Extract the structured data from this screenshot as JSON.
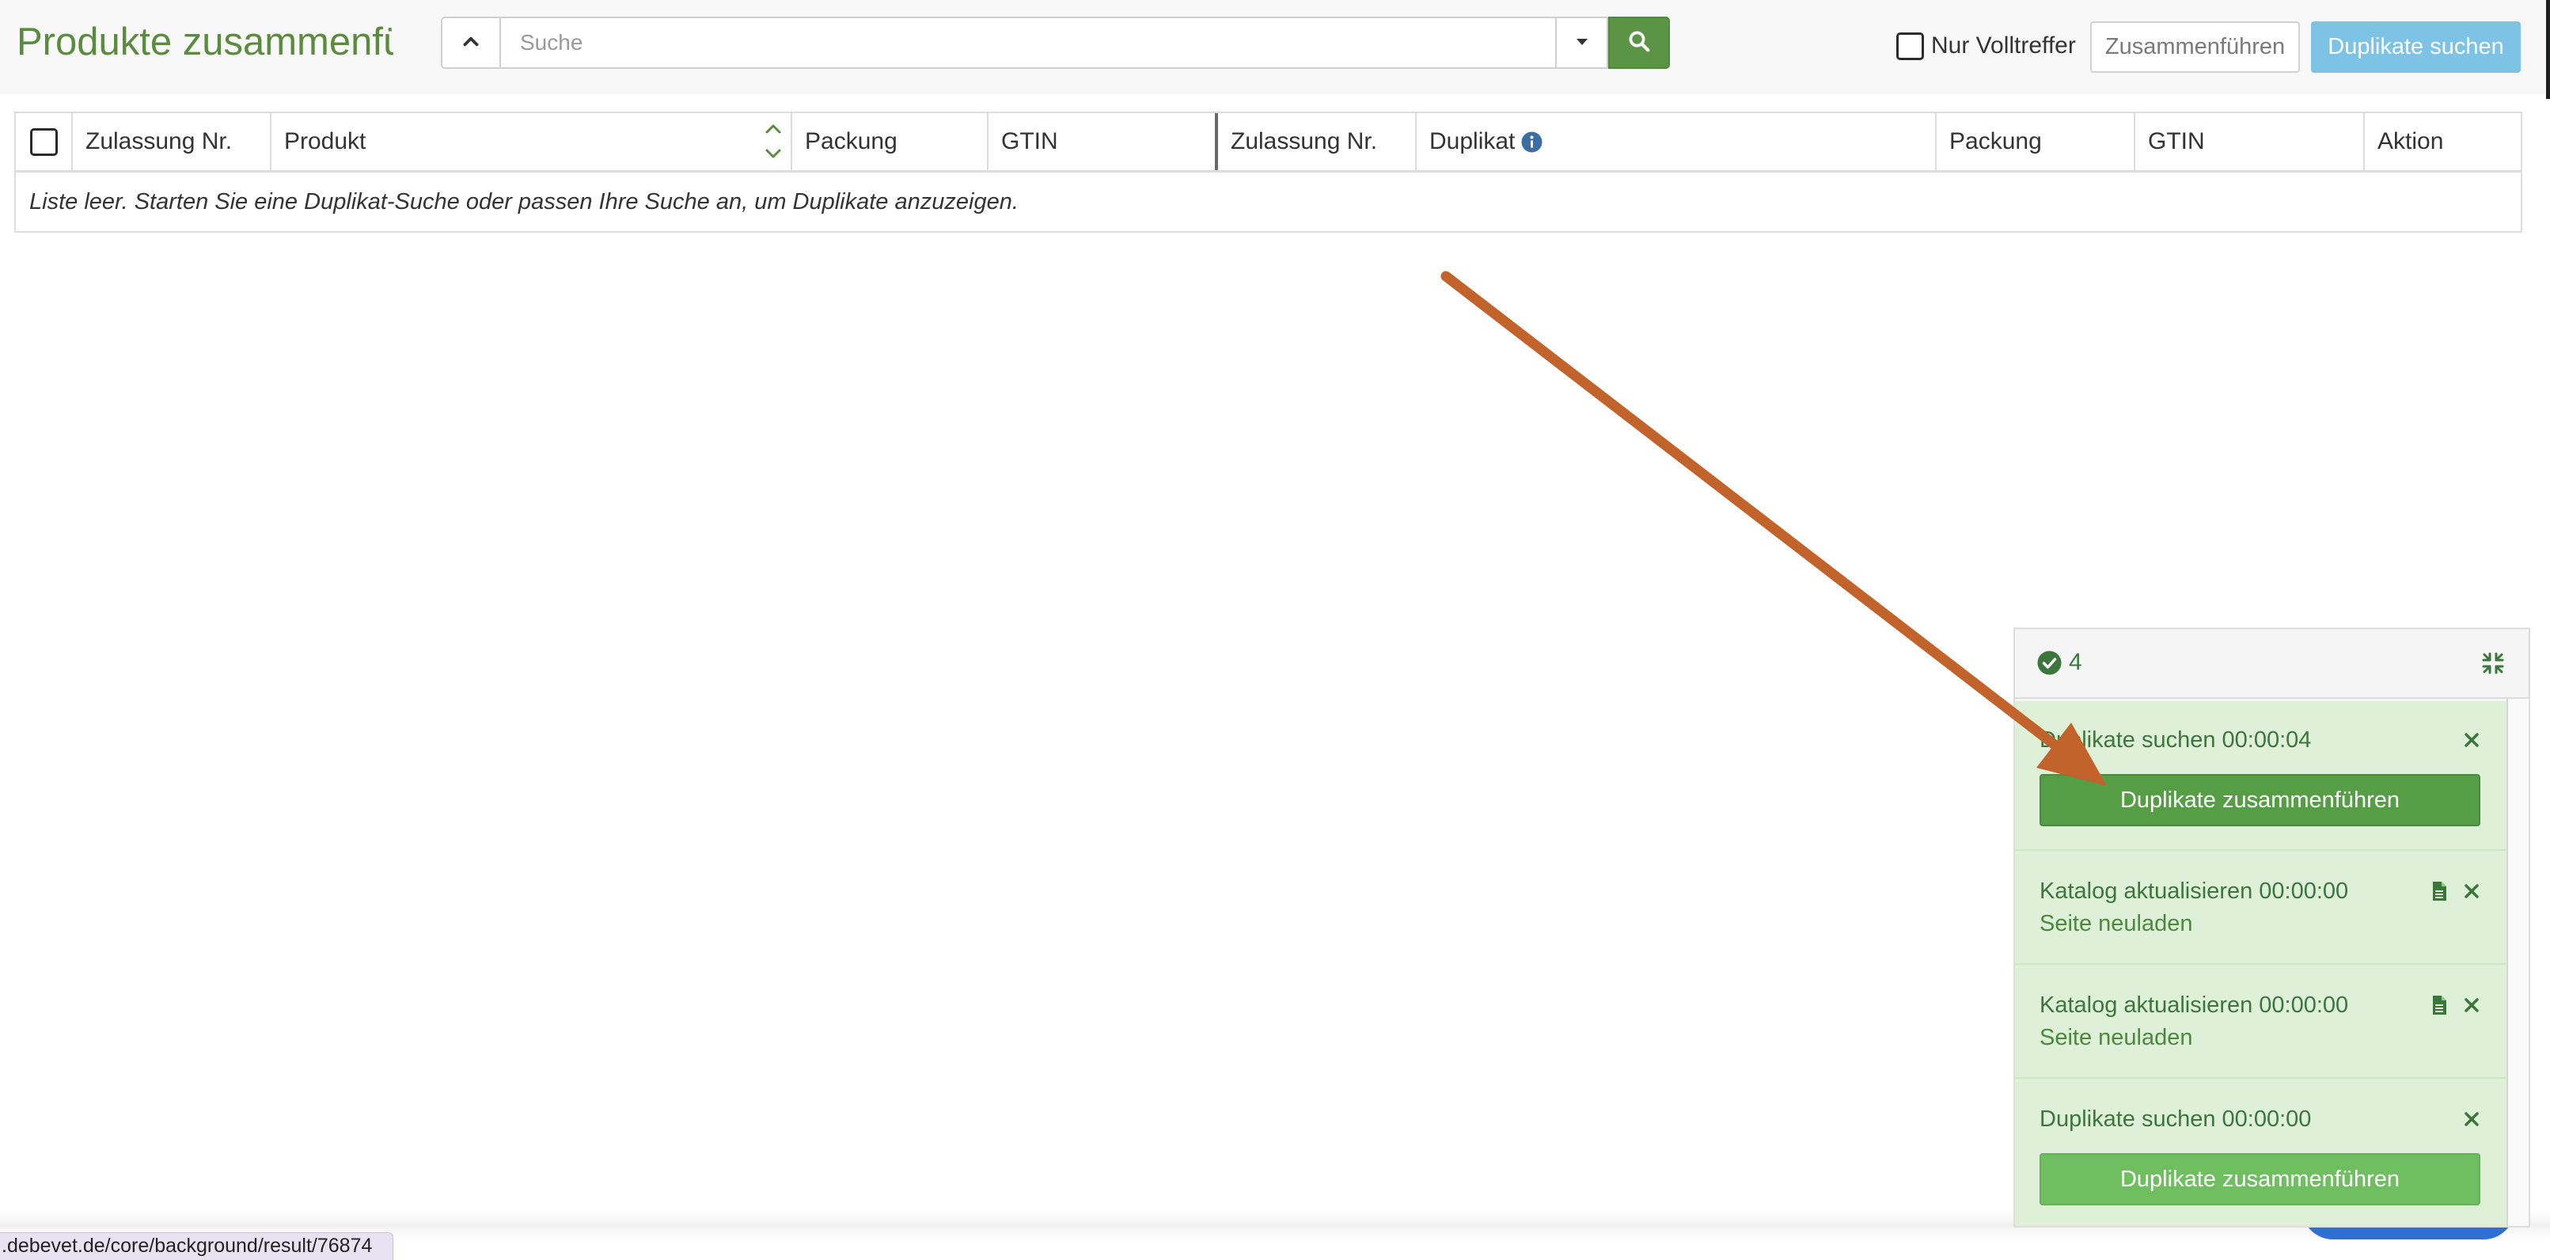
{
  "header": {
    "title": "Produkte zusammenfü",
    "search": {
      "placeholder": "Suche",
      "value": ""
    },
    "only_exact_label": "Nur Volltreffer",
    "only_exact_checked": false,
    "merge_button": "Zusammenführen",
    "find_duplicates_button": "Duplikate suchen"
  },
  "table": {
    "select_all_checked": false,
    "columns": [
      "Zulassung Nr.",
      "Produkt",
      "Packung",
      "GTIN",
      "Zulassung Nr.",
      "Duplikat",
      "Packung",
      "GTIN",
      "Aktion"
    ],
    "sorted_column": "Produkt",
    "empty_message": "Liste leer. Starten Sie eine Duplikat-Suche oder passen Ihre Suche an, um Duplikate anzuzeigen."
  },
  "jobs_panel": {
    "count": "4",
    "items": [
      {
        "title": "Duplikate suchen 00:00:04",
        "action": "Duplikate zusammenführen"
      },
      {
        "title": "Katalog aktualisieren 00:00:00",
        "link": "Seite neuladen"
      },
      {
        "title": "Katalog aktualisieren 00:00:00",
        "link": "Seite neuladen"
      },
      {
        "title": "Duplikate suchen 00:00:00",
        "action": "Duplikate zusammenführen"
      }
    ]
  },
  "status_bar": {
    "url": ".debevet.de/core/background/result/76874"
  },
  "icons": {
    "search_toggle": "chevron-up-icon",
    "search_dropdown": "caret-down-icon",
    "search_submit": "search-icon",
    "sort": "sort-icon",
    "column_info": "info-icon",
    "panel_status": "check-circle-icon",
    "panel_collapse": "compress-icon",
    "job_dismiss": "close-icon",
    "job_log": "file-icon"
  },
  "colors": {
    "brand_green": "#5b8c3e",
    "success_bg": "#dff0d8",
    "success_text": "#3c763d",
    "merge_action_dark": "#559e45",
    "merge_action_light": "#6fbf60",
    "find_button": "#7cc3e6",
    "info_icon": "#3b6ea5",
    "annotation_arrow": "#c2632b",
    "status_bar_bg": "#e8e3f1"
  }
}
